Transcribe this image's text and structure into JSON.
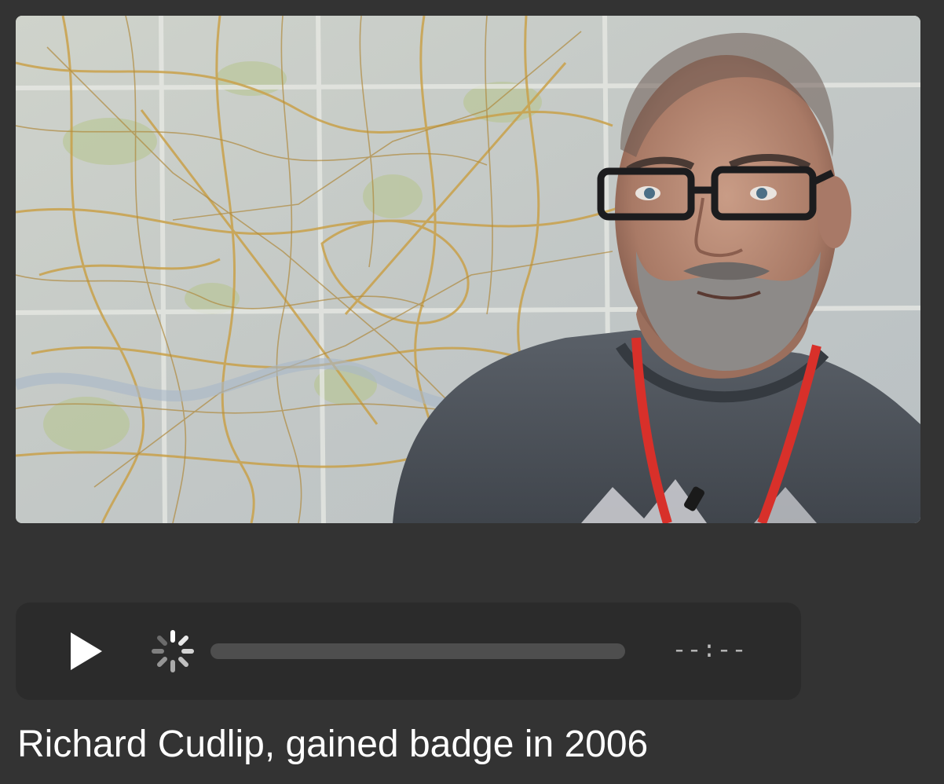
{
  "video": {
    "still_image": "interview-portrait",
    "background_subject": "street-map"
  },
  "player": {
    "play_icon": "play-icon",
    "loading_icon": "loading-spinner-icon",
    "progress_fraction": 0,
    "time": "--:--",
    "colors": {
      "bar_background": "#2b2b2b",
      "track": "#4e4e4e",
      "icon": "#ffffff",
      "time_text": "#bdbdbd"
    }
  },
  "caption": "Richard Cudlip, gained badge in 2006"
}
